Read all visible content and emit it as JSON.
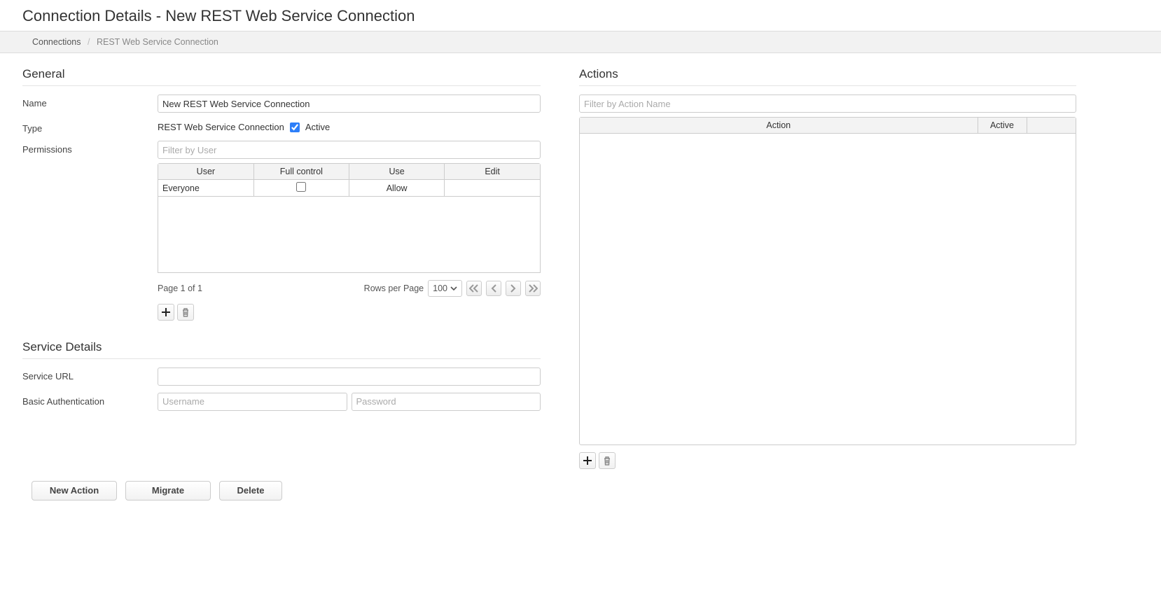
{
  "page_title": "Connection Details - New REST Web Service Connection",
  "breadcrumb": {
    "link": "Connections",
    "current": "REST Web Service Connection"
  },
  "general": {
    "header": "General",
    "name_label": "Name",
    "name_value": "New REST Web Service Connection",
    "type_label": "Type",
    "type_value": "REST Web Service Connection",
    "active_label": "Active",
    "active_checked": "true",
    "permissions_label": "Permissions",
    "perm_filter_placeholder": "Filter by User",
    "perm_columns": {
      "user": "User",
      "full": "Full control",
      "use": "Use",
      "edit": "Edit"
    },
    "perm_rows": [
      {
        "user": "Everyone",
        "full_checked": "false",
        "use": "Allow",
        "edit": ""
      }
    ],
    "pager_text": "Page 1 of 1",
    "rows_label": "Rows per Page",
    "rows_value": "100"
  },
  "service": {
    "header": "Service Details",
    "url_label": "Service URL",
    "auth_label": "Basic Authentication",
    "username_placeholder": "Username",
    "password_placeholder": "Password"
  },
  "buttons": {
    "new_action": "New Action",
    "migrate": "Migrate",
    "delete": "Delete"
  },
  "actions": {
    "header": "Actions",
    "filter_placeholder": "Filter by Action Name",
    "columns": {
      "action": "Action",
      "active": "Active"
    }
  }
}
